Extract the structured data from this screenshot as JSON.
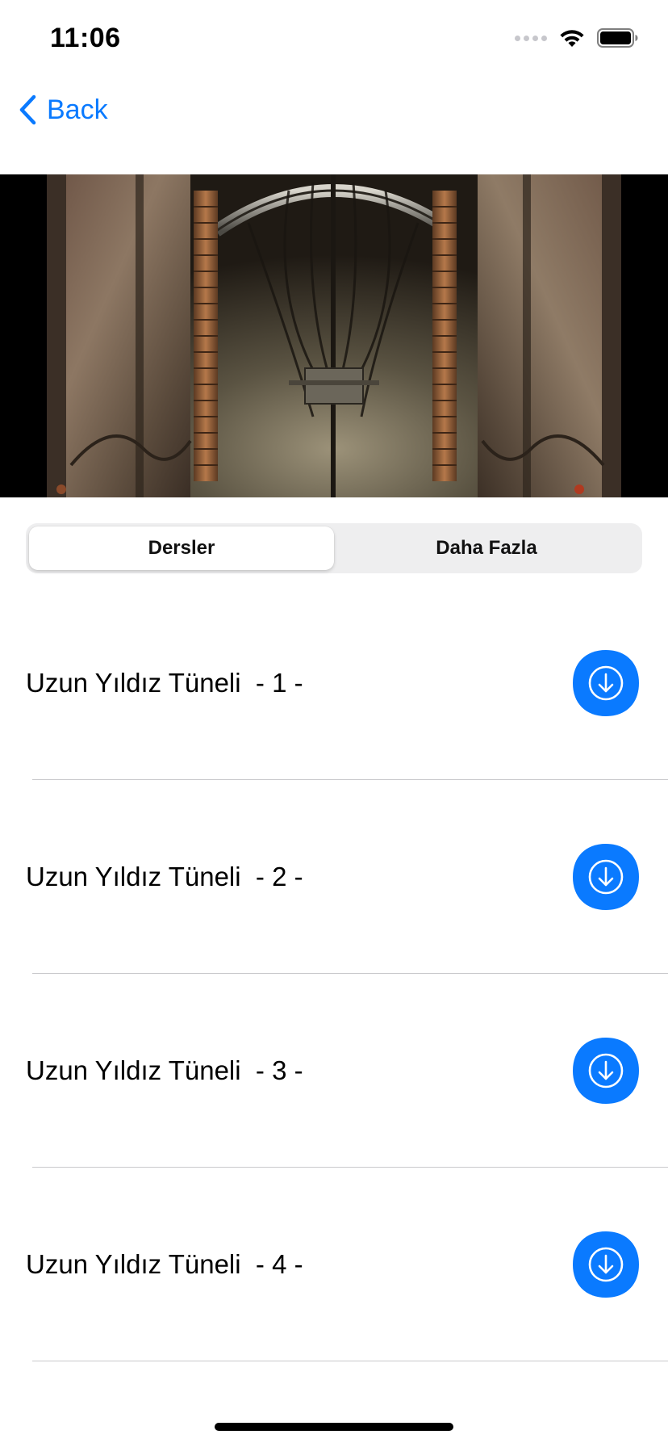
{
  "status_bar": {
    "time": "11:06",
    "icons": [
      "cellular-signal-icon",
      "wifi-icon",
      "battery-icon"
    ]
  },
  "nav": {
    "back_label": "Back",
    "back_icon": "chevron-left-icon",
    "accent_color": "#0a7aff"
  },
  "hero": {
    "image": "video-thumbnail"
  },
  "segmented": {
    "options": [
      "Dersler",
      "Daha Fazla"
    ],
    "selected": "Dersler"
  },
  "lessons": [
    {
      "title": "Uzun Yıldız Tüneli  - 1 -",
      "action_icon": "download-icon"
    },
    {
      "title": "Uzun Yıldız Tüneli  - 2 -",
      "action_icon": "download-icon"
    },
    {
      "title": "Uzun Yıldız Tüneli  - 3 -",
      "action_icon": "download-icon"
    },
    {
      "title": "Uzun Yıldız Tüneli  - 4 -",
      "action_icon": "download-icon"
    }
  ]
}
